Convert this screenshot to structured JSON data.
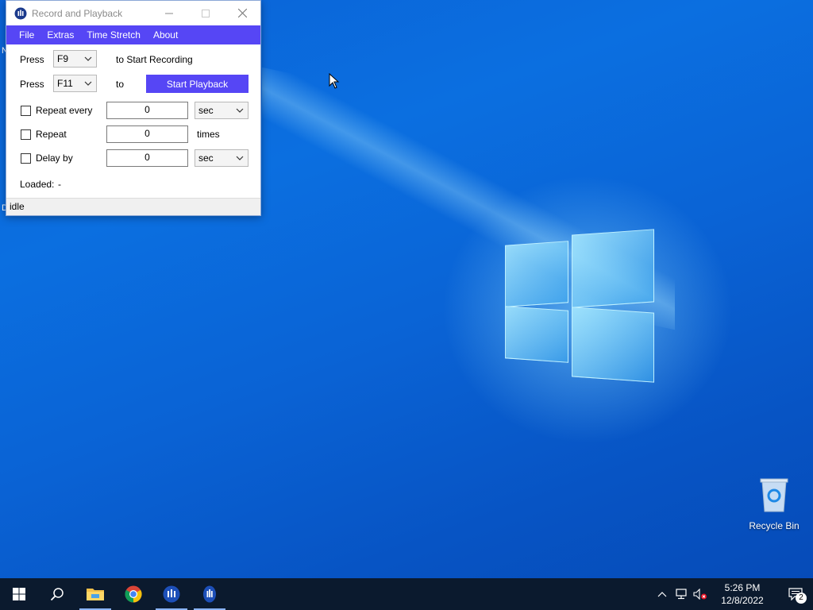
{
  "window": {
    "title": "Record and Playback",
    "menu": [
      "File",
      "Extras",
      "Time Stretch",
      "About"
    ],
    "record_row": {
      "prefix": "Press",
      "key": "F9",
      "suffix": "to Start Recording"
    },
    "playback_row": {
      "prefix": "Press",
      "key": "F11",
      "suffix": "to",
      "button": "Start Playback"
    },
    "repeat_every": {
      "label": "Repeat every",
      "value": "0",
      "unit": "sec",
      "checked": false
    },
    "repeat": {
      "label": "Repeat",
      "value": "0",
      "unit": "times",
      "checked": false
    },
    "delay_by": {
      "label": "Delay by",
      "value": "0",
      "unit": "sec",
      "checked": false
    },
    "loaded": {
      "label": "Loaded:",
      "value": "-"
    },
    "status": "idle",
    "accent_color": "#5646f5"
  },
  "desktop": {
    "icons": [
      {
        "label": "Recycle Bin",
        "icon": "recycle-bin-icon"
      }
    ],
    "edge_letters": [
      "N",
      "D"
    ]
  },
  "taskbar": {
    "pinned": [
      {
        "name": "start",
        "icon": "windows-icon"
      },
      {
        "name": "search",
        "icon": "search-icon"
      },
      {
        "name": "file-explorer",
        "icon": "folder-icon"
      },
      {
        "name": "chrome",
        "icon": "chrome-icon"
      },
      {
        "name": "record-playback-1",
        "icon": "app-icon"
      },
      {
        "name": "record-playback-2",
        "icon": "app-icon"
      }
    ],
    "clock": {
      "time": "5:26 PM",
      "date": "12/8/2022"
    },
    "notifications_count": "2"
  }
}
